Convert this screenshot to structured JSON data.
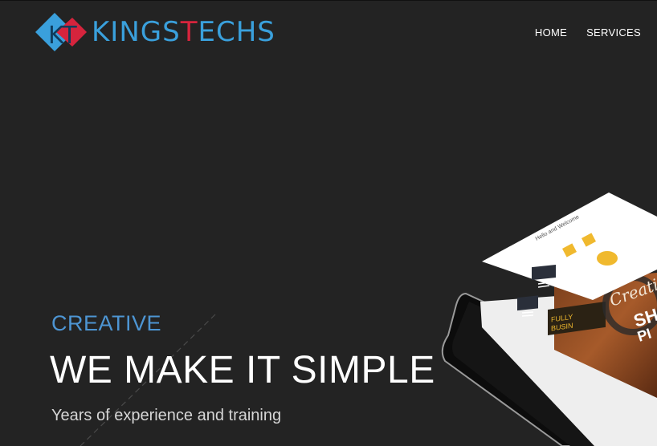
{
  "brand": {
    "prefix": "KINGS",
    "accent": "T",
    "suffix": "ECHS",
    "logo_letters": "KT",
    "colors": {
      "blue": "#3aa0dc",
      "red": "#d6243d"
    }
  },
  "nav": {
    "items": [
      {
        "label": "HOME"
      },
      {
        "label": "SERVICES"
      }
    ]
  },
  "hero": {
    "kicker": "CREATIVE",
    "headline": "WE MAKE IT SIMPLE",
    "subline": "Years of experience and training"
  },
  "mockup": {
    "welcome": "Hello and Welcome",
    "promo_line1": "FULLY",
    "promo_line2": "BUSIN",
    "creative_word": "Creati",
    "big_letters_1": "SH",
    "big_letters_2": "PI"
  },
  "colors": {
    "background": "#232323",
    "kicker": "#4d95d3",
    "social_yellow": "#f0b92e"
  }
}
